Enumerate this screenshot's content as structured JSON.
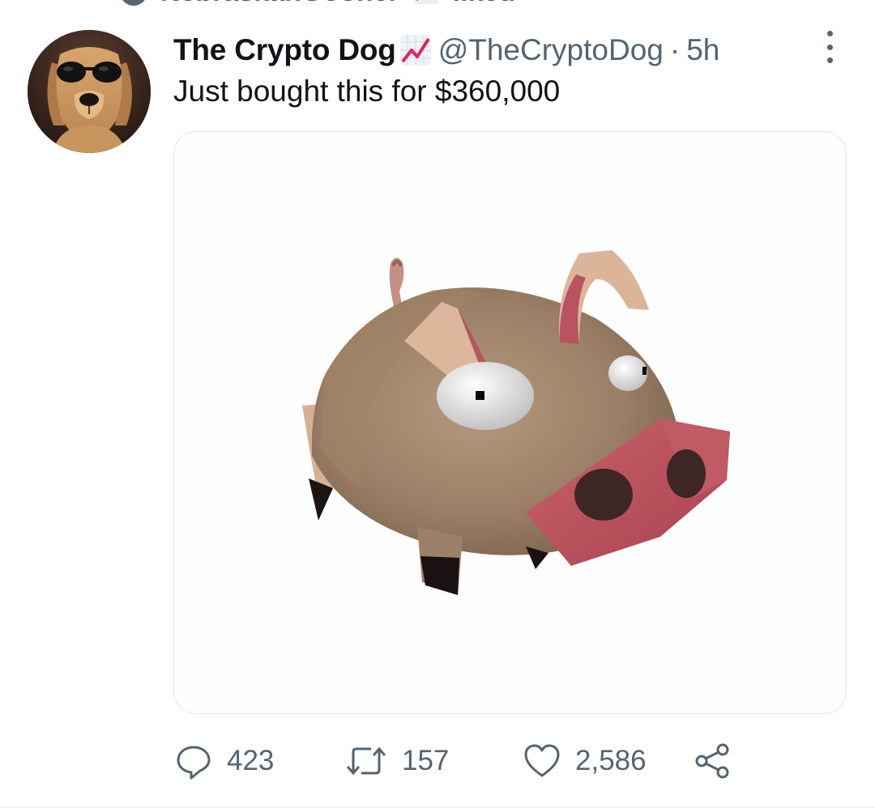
{
  "social_context": {
    "user": "NebraskanGooner",
    "action": "liked"
  },
  "tweet": {
    "author": {
      "display_name": "The Crypto Dog",
      "handle": "@TheCryptoDog",
      "avatar_icon": "dog-with-sunglasses-avatar"
    },
    "separator": "·",
    "timestamp": "5h",
    "text": "Just bought this for $360,000",
    "media_description_icon": "low-poly-pig-image",
    "stats": {
      "replies": "423",
      "retweets": "157",
      "likes": "2,586"
    }
  },
  "colors": {
    "text_primary": "#0f1419",
    "text_secondary": "#536471",
    "border": "#e1e6ea",
    "chart_emoji_line": "#e0245e"
  }
}
